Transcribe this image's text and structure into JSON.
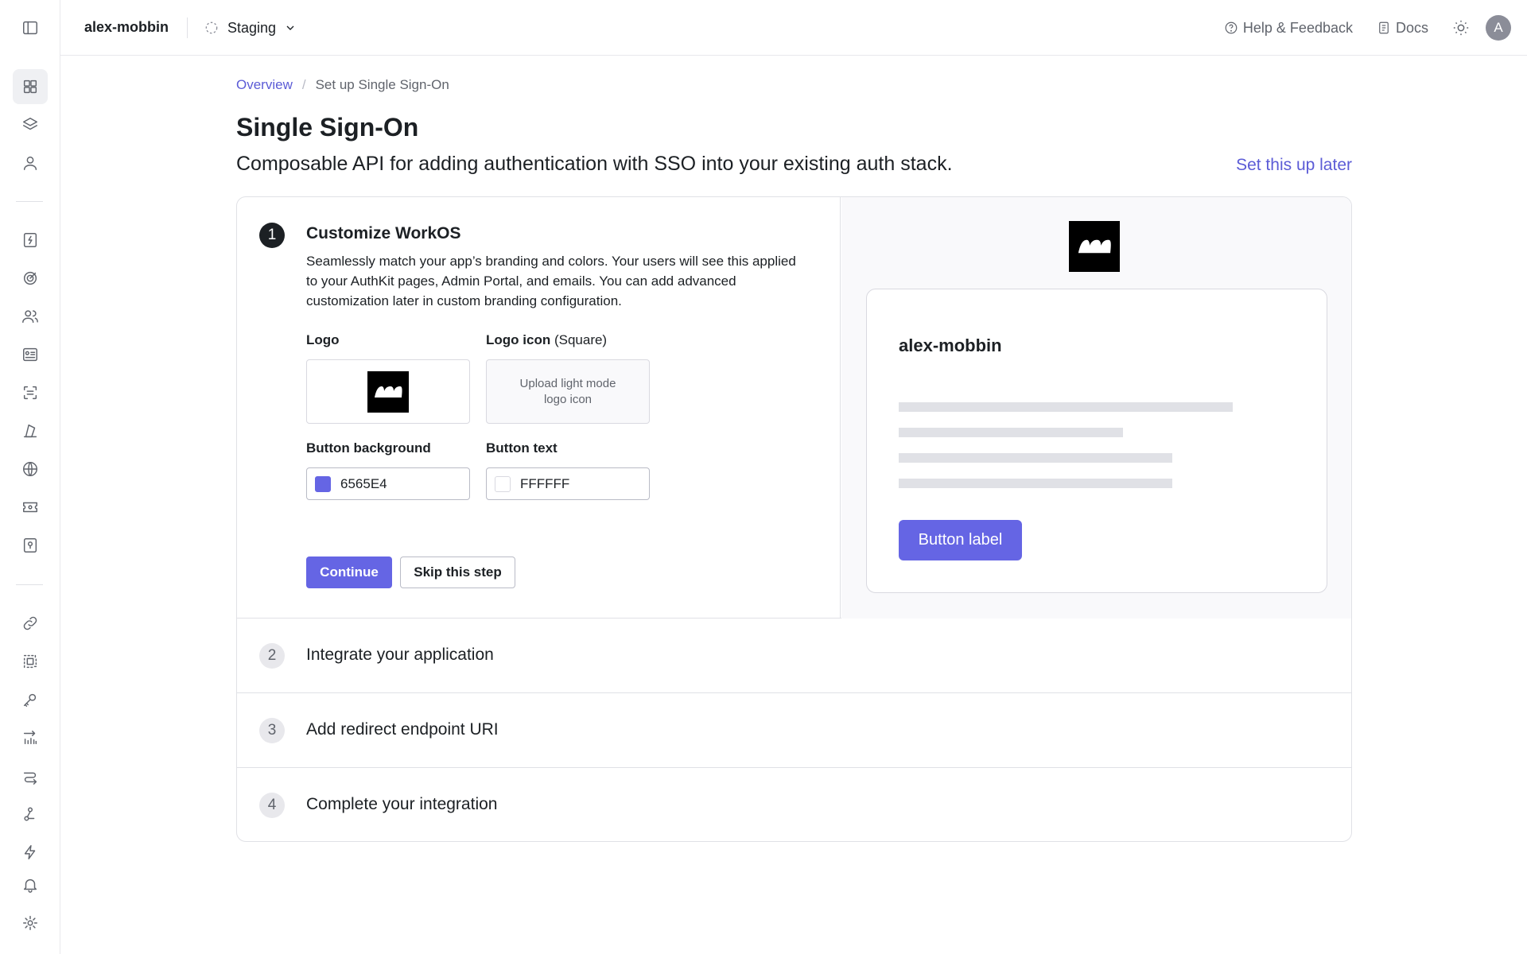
{
  "header": {
    "org_name": "alex-mobbin",
    "environment": "Staging",
    "help_label": "Help & Feedback",
    "docs_label": "Docs",
    "avatar_initial": "A"
  },
  "sidebar": {
    "icons": [
      "panel-toggle-icon",
      "dashboard-icon",
      "layers-icon",
      "user-icon",
      "authkit-icon",
      "target-icon",
      "users-icon",
      "directory-icon",
      "scan-icon",
      "audit-icon",
      "globe-icon",
      "ticket-icon",
      "vault-icon",
      "link-icon",
      "select-icon",
      "key-icon",
      "metrics-icon",
      "routing-icon",
      "webhook-icon",
      "events-icon",
      "bell-icon",
      "gear-icon"
    ]
  },
  "breadcrumb": {
    "parent": "Overview",
    "separator": "/",
    "current": "Set up Single Sign-On"
  },
  "page": {
    "title": "Single Sign-On",
    "subtitle": "Composable API for adding authentication with SSO into your existing auth stack.",
    "later_link": "Set this up later"
  },
  "step1": {
    "number": "1",
    "title": "Customize WorkOS",
    "description": "Seamlessly match your app’s branding and colors. Your users will see this applied to your AuthKit pages, Admin Portal, and emails. You can add advanced customization later in custom branding configuration.",
    "logo_label": "Logo",
    "logo_icon_label": "Logo icon",
    "logo_icon_hint": "(Square)",
    "upload_placeholder": "Upload light mode logo icon",
    "button_bg_label": "Button background",
    "button_bg_value": "6565E4",
    "button_bg_color": "#6565e4",
    "button_text_label": "Button text",
    "button_text_value": "FFFFFF",
    "button_text_color": "#ffffff",
    "continue_label": "Continue",
    "skip_label": "Skip this step"
  },
  "preview": {
    "org_name": "alex-mobbin",
    "button_label": "Button label"
  },
  "steps": [
    {
      "number": "2",
      "label": "Integrate your application"
    },
    {
      "number": "3",
      "label": "Add redirect endpoint URI"
    },
    {
      "number": "4",
      "label": "Complete your integration"
    }
  ],
  "colors": {
    "accent": "#5b5bd6",
    "primary_button": "#6565e4"
  }
}
